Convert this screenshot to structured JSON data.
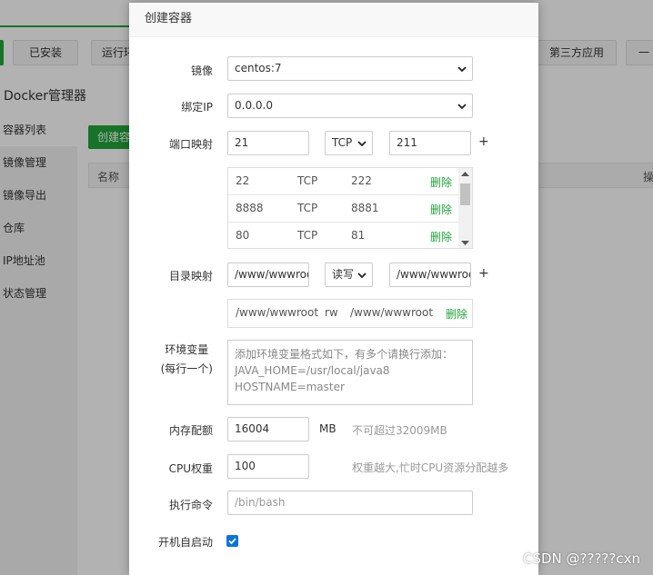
{
  "background": {
    "tabs": [
      "已安装",
      "运行环",
      "第三方应用",
      "一"
    ],
    "title": "Docker管理器",
    "sidebar": [
      "容器列表",
      "镜像管理",
      "镜像导出",
      "仓库",
      "IP地址池",
      "状态管理"
    ],
    "create_button": "创建容",
    "table_headers": {
      "name": "名称",
      "ops": "操"
    }
  },
  "modal": {
    "title": "创建容器",
    "image": {
      "label": "镜像",
      "value": "centos:7"
    },
    "bind_ip": {
      "label": "绑定IP",
      "value": "0.0.0.0"
    },
    "port": {
      "label": "端口映射",
      "host": "21",
      "protocol": "TCP",
      "container": "211",
      "add": "+",
      "rows": [
        {
          "host": "22",
          "protocol": "TCP",
          "container": "222",
          "delete": "删除"
        },
        {
          "host": "8888",
          "protocol": "TCP",
          "container": "8881",
          "delete": "删除"
        },
        {
          "host": "80",
          "protocol": "TCP",
          "container": "81",
          "delete": "删除"
        }
      ]
    },
    "dir": {
      "label": "目录映射",
      "host": "/www/wwwroot",
      "mode": "读写",
      "container": "/www/wwwroot",
      "add": "+",
      "rows": [
        {
          "host": "/www/wwwroot",
          "mode": "rw",
          "container": "/www/wwwroot",
          "delete": "删除"
        }
      ]
    },
    "env": {
      "label": "环境变量",
      "sublabel": "(每行一个)",
      "lines": [
        "添加环境变量格式如下，有多个请换行添加：",
        "JAVA_HOME=/usr/local/java8",
        "HOSTNAME=master"
      ]
    },
    "memory": {
      "label": "内存配额",
      "value": "16004",
      "unit": "MB",
      "hint": "不可超过32009MB"
    },
    "cpu": {
      "label": "CPU权重",
      "value": "100",
      "hint": "权重越大,忙时CPU资源分配越多"
    },
    "command": {
      "label": "执行命令",
      "placeholder": "/bin/bash"
    },
    "autostart": {
      "label": "开机自启动",
      "checked": true
    }
  },
  "watermark": "CSDN @?????cxn",
  "colors": {
    "accent": "#20a53a",
    "checkbox": "#0a74da"
  }
}
